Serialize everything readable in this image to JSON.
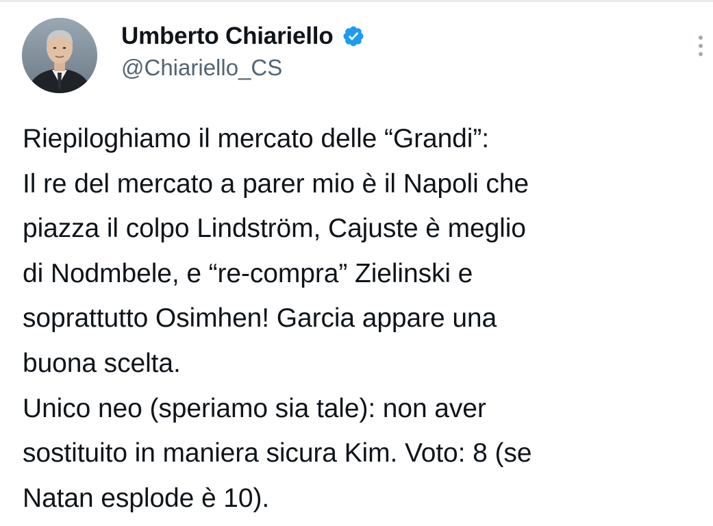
{
  "author": {
    "display_name": "Umberto Chiariello",
    "handle": "@Chiariello_CS",
    "verified": true,
    "avatar_icon": "profile-photo-man-in-suit",
    "verified_icon": "verified-badge-icon",
    "verified_color": "#1d9bf0"
  },
  "menu": {
    "icon": "more-vertical-icon"
  },
  "tweet": {
    "lines": [
      "Riepiloghiamo il mercato delle “Grandi”:",
      "Il re del mercato a parer mio è il Napoli che",
      "piazza il colpo Lindström, Cajuste è meglio",
      "di Nodmbele, e “re-compra” Zielinski e",
      "soprattutto Osimhen! Garcia appare una",
      "buona scelta.",
      "Unico neo (speriamo sia tale): non aver",
      "sostituito in maniera sicura Kim. Voto: 8 (se",
      "Natan esplode è 10)."
    ]
  }
}
